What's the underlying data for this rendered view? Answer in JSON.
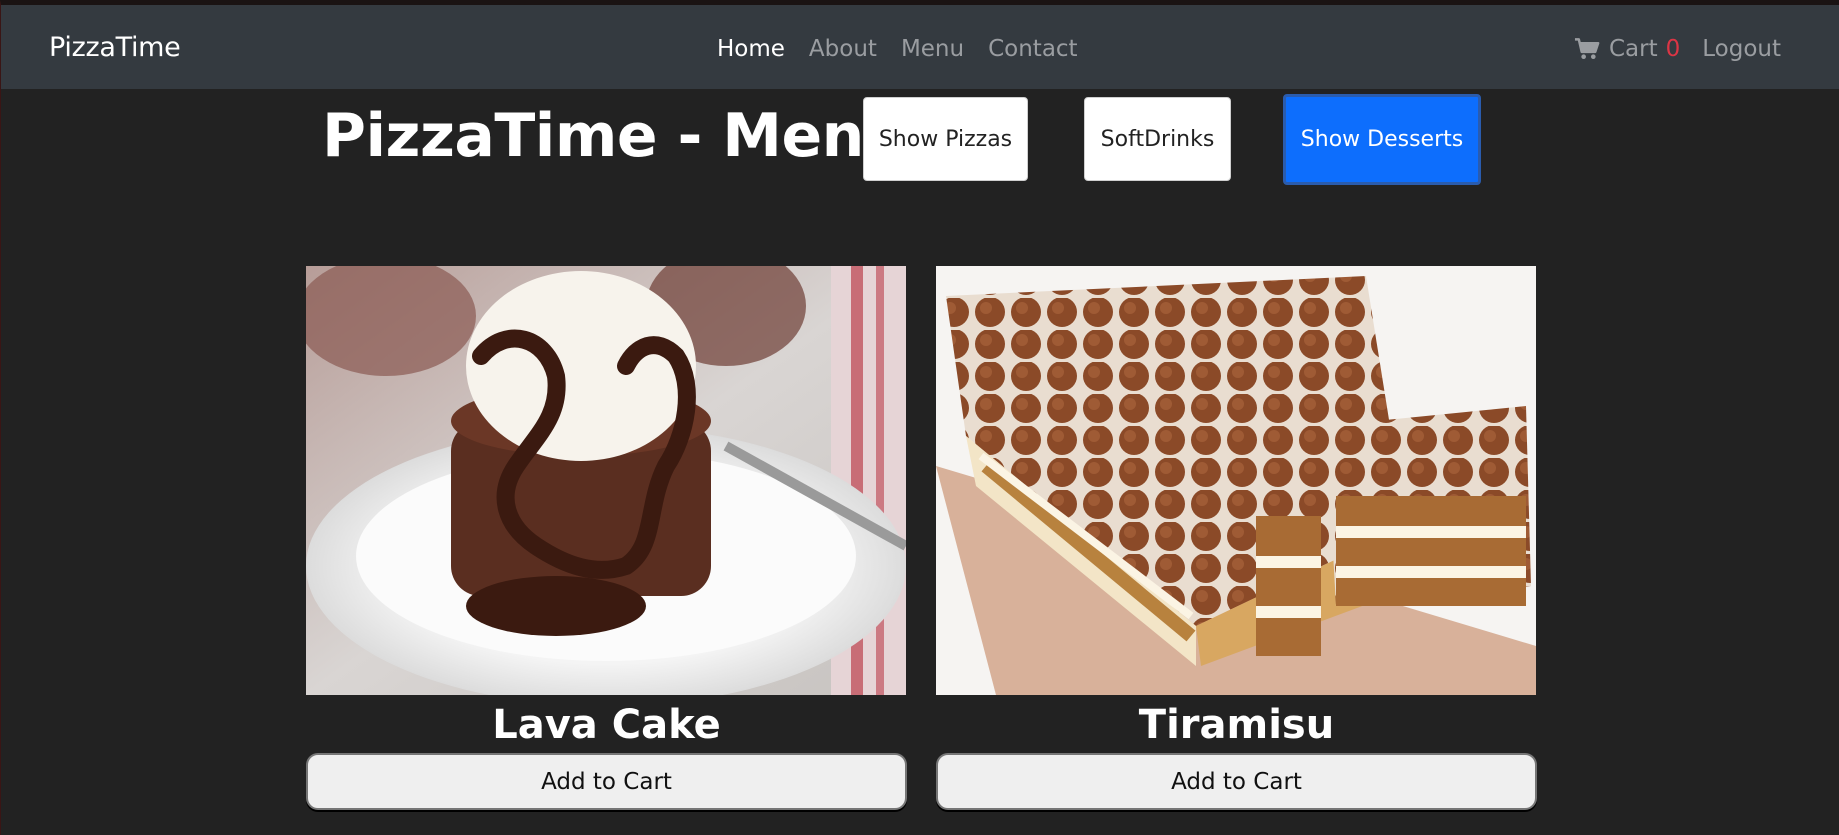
{
  "navbar": {
    "brand": "PizzaTime",
    "links": [
      "Home",
      "About",
      "Menu",
      "Contact"
    ],
    "cart_label": "Cart",
    "cart_count": "0",
    "logout_label": "Logout"
  },
  "page": {
    "title": "PizzaTime - Menu"
  },
  "filters": {
    "pizzas": "Show Pizzas",
    "drinks": "SoftDrinks",
    "desserts": "Show Desserts",
    "active": "desserts"
  },
  "products": [
    {
      "name": "Lava Cake",
      "button": "Add to Cart"
    },
    {
      "name": "Tiramisu",
      "button": "Add to Cart"
    }
  ],
  "colors": {
    "navbar_bg": "#343a40",
    "page_bg": "#222222",
    "accent": "#0d6efd",
    "cart_count": "#dc3545"
  },
  "icons": {
    "cart": "shopping-cart-icon"
  }
}
